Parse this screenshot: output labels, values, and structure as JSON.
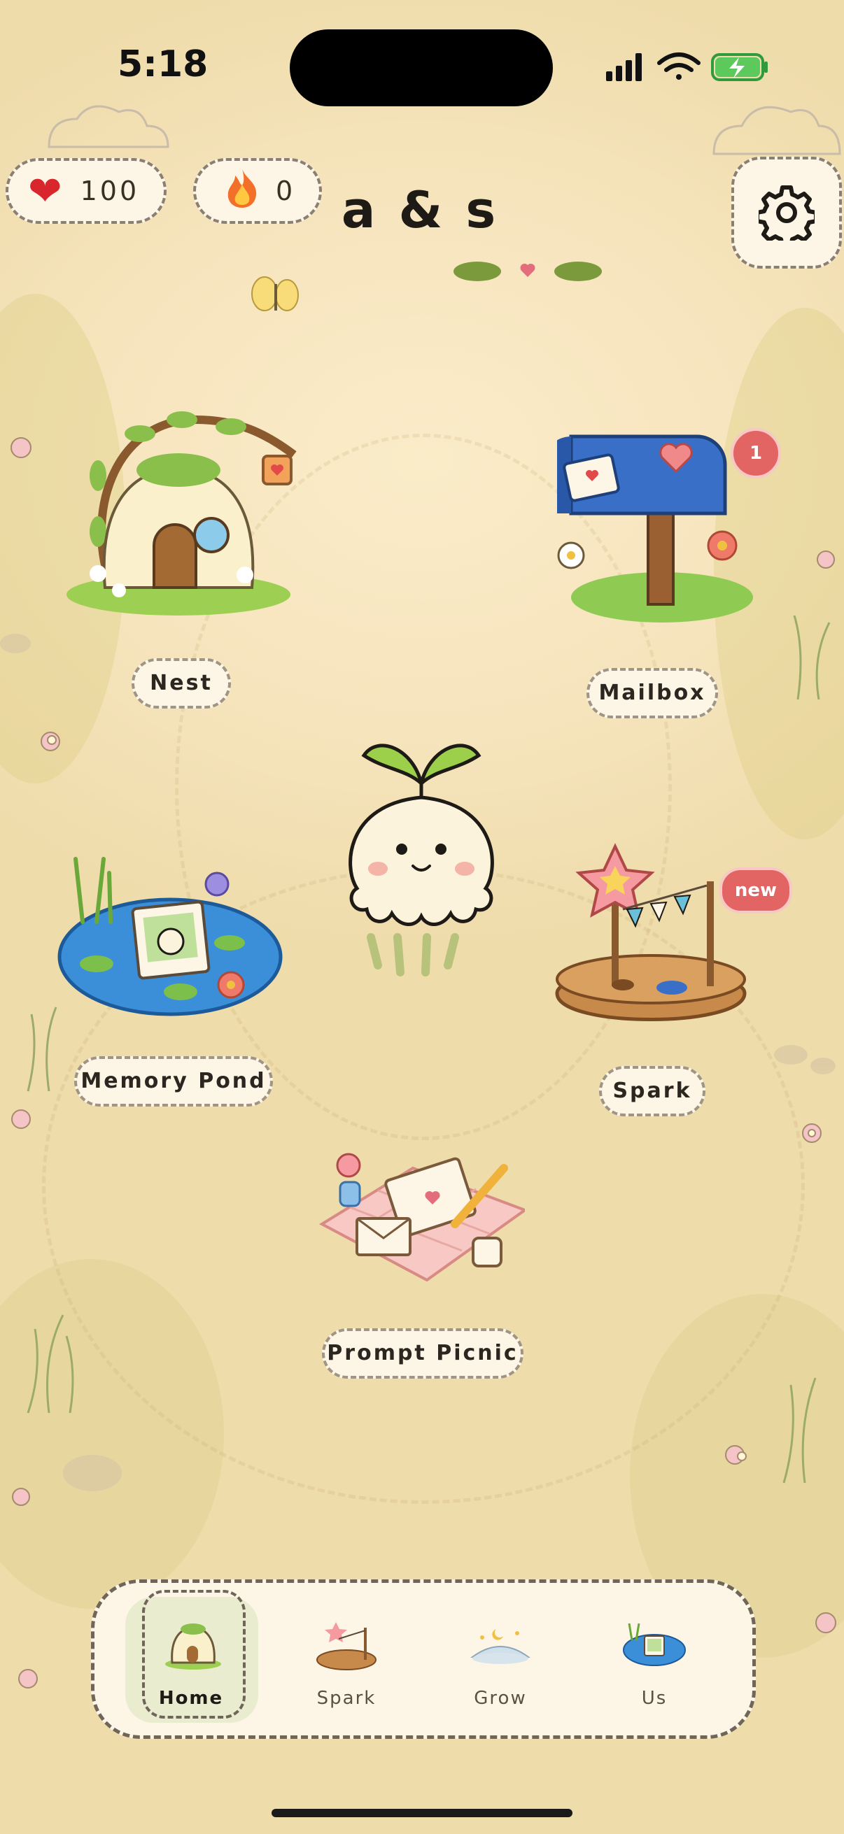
{
  "status_bar": {
    "time": "5:18"
  },
  "header": {
    "hearts": {
      "icon": "heart-icon",
      "value": "100"
    },
    "streak": {
      "icon": "fire-icon",
      "value": "0"
    },
    "couple_name": "a & s",
    "settings_icon": "gear-icon"
  },
  "map": {
    "locations": [
      {
        "id": "nest",
        "label": "Nest",
        "icon": "mushroom-house-icon"
      },
      {
        "id": "mailbox",
        "label": "Mailbox",
        "icon": "mailbox-icon",
        "badge": "1"
      },
      {
        "id": "memory-pond",
        "label": "Memory Pond",
        "icon": "pond-icon"
      },
      {
        "id": "spark",
        "label": "Spark",
        "icon": "star-stage-icon",
        "badge": "new"
      },
      {
        "id": "prompt-picnic",
        "label": "Prompt Picnic",
        "icon": "picnic-blanket-icon"
      }
    ],
    "mascot": "sprout-mascot-icon"
  },
  "nav": {
    "items": [
      {
        "label": "Home",
        "icon": "home-nav-icon",
        "active": true
      },
      {
        "label": "Spark",
        "icon": "spark-nav-icon",
        "active": false
      },
      {
        "label": "Grow",
        "icon": "grow-nav-icon",
        "active": false
      },
      {
        "label": "Us",
        "icon": "us-nav-icon",
        "active": false
      }
    ]
  },
  "colors": {
    "background": "#f6e6c2",
    "card": "#fdf6e6",
    "badge": "#e26463",
    "leaf": "#8cb34a",
    "mailbox_blue": "#3a6fc8"
  }
}
